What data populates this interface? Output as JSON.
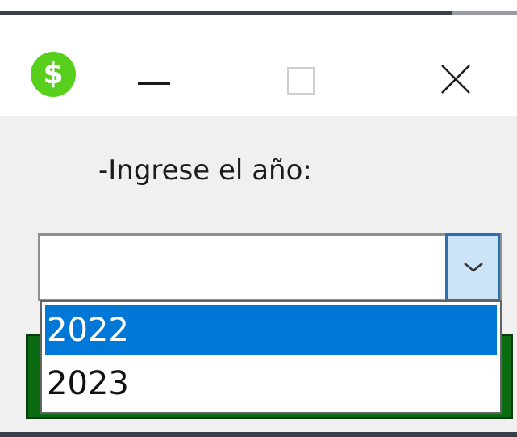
{
  "window": {
    "app_icon": {
      "name": "dollar-icon",
      "glyph": "$",
      "color": "#57cf1c"
    },
    "controls": {
      "minimize_icon": "minimize-icon",
      "maximize_icon": "maximize-icon",
      "close_icon": "close-icon"
    }
  },
  "form": {
    "year_label": "-Ingrese el año:",
    "year_select": {
      "value": "",
      "options": [
        "2022",
        "2023"
      ],
      "highlighted_index": 0,
      "dropdown_open": true
    }
  },
  "colors": {
    "accent": "#0078d7",
    "arrow_button_bg": "#cce4f7",
    "arrow_button_border": "#2c6fb0",
    "button_behind": "#0a6b10"
  }
}
